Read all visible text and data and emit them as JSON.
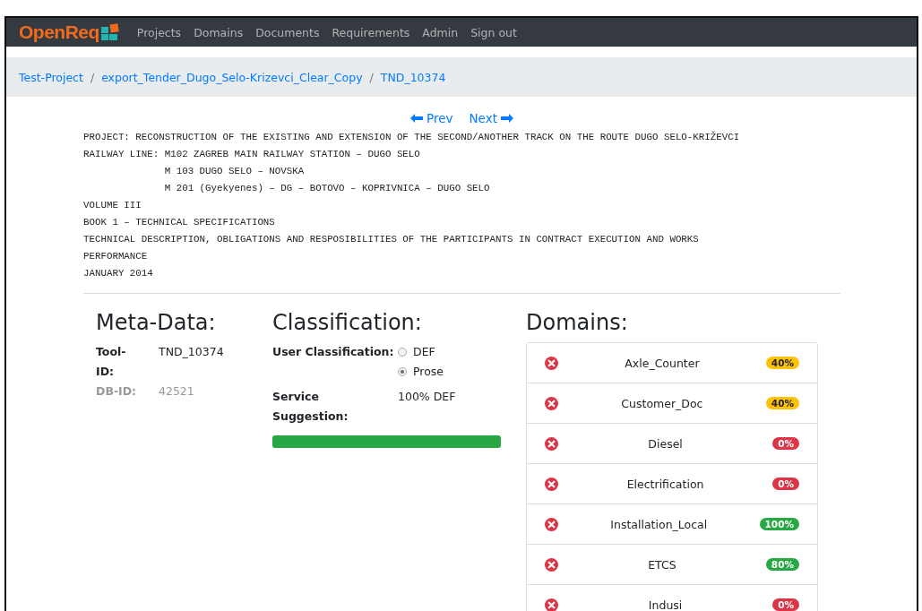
{
  "navbar": {
    "brand": "OpenReq",
    "links": [
      "Projects",
      "Domains",
      "Documents",
      "Requirements",
      "Admin",
      "Sign out"
    ]
  },
  "breadcrumb": {
    "separator": "/",
    "items": [
      "Test-Project",
      "export_Tender_Dugo_Selo-Krizevci_Clear_Copy",
      "TND_10374"
    ]
  },
  "pager": {
    "prev": "Prev",
    "next": "Next"
  },
  "document_text": "PROJECT: RECONSTRUCTION OF THE EXISTING AND EXTENSION OF THE SECOND/ANOTHER TRACK ON THE ROUTE DUGO SELO-KRIŽEVCI\nRAILWAY LINE: M102 ZAGREB MAIN RAILWAY STATION – DUGO SELO\n              M 103 DUGO SELO – NOVSKA\n              M 201 (Gyekyenes) – DG – BOTOVO – KOPRIVNICA – DUGO SELO\nVOLUME III\nBOOK 1 – TECHNICAL SPECIFICATIONS\nTECHNICAL DESCRIPTION, OBLIGATIONS AND RESPOSIBILITIES OF THE PARTICIPANTS IN CONTRACT EXECUTION AND WORKS\nPERFORMANCE\nJANUARY 2014",
  "meta_data": {
    "title": "Meta-Data:",
    "fields": [
      {
        "label": "Tool-ID:",
        "value": "TND_10374",
        "disabled": false
      },
      {
        "label": "DB-ID:",
        "value": "42521",
        "disabled": true
      }
    ]
  },
  "classification": {
    "title": "Classification:",
    "user_label": "User Classification:",
    "options": [
      {
        "label": "DEF",
        "selected": false
      },
      {
        "label": "Prose",
        "selected": true
      }
    ],
    "service_label": "Service Suggestion:",
    "service_value": "100% DEF",
    "level": 1.0
  },
  "domains": {
    "title": "Domains:",
    "items": [
      {
        "name": "Axle_Counter",
        "badge": "40%",
        "color": "#ffc107"
      },
      {
        "name": "Customer_Doc",
        "badge": "40%",
        "color": "#ffc107"
      },
      {
        "name": "Diesel",
        "badge": "0%",
        "color": "#dc3545"
      },
      {
        "name": "Electrification",
        "badge": "0%",
        "color": "#dc3545"
      },
      {
        "name": "Installation_Local",
        "badge": "100%",
        "color": "#28a745"
      },
      {
        "name": "ETCS",
        "badge": "80%",
        "color": "#28a745"
      },
      {
        "name": "Indusi",
        "badge": "0%",
        "color": "#dc3545"
      }
    ]
  }
}
